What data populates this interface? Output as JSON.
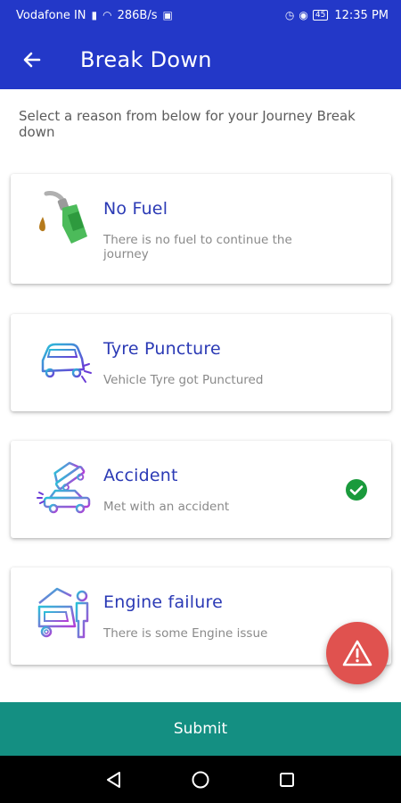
{
  "status_bar": {
    "carrier": "Vodafone IN",
    "speed": "286B/s",
    "battery": "45",
    "time": "12:35 PM"
  },
  "app_bar": {
    "title": "Break Down"
  },
  "prompt": "Select a reason from below for your Journey Break down",
  "reasons": [
    {
      "title": "No Fuel",
      "subtitle": "There is no fuel to continue the journey",
      "icon": "fuel-pump-icon",
      "selected": false
    },
    {
      "title": "Tyre Puncture",
      "subtitle": "Vehicle Tyre got Punctured",
      "icon": "car-puncture-icon",
      "selected": false
    },
    {
      "title": "Accident",
      "subtitle": "Met with an accident",
      "icon": "car-accident-icon",
      "selected": true
    },
    {
      "title": "Engine failure",
      "subtitle": "There is some Engine issue",
      "icon": "engine-repair-icon",
      "selected": false
    }
  ],
  "submit_label": "Submit",
  "colors": {
    "primary": "#2338c8",
    "title_text": "#2b3ab5",
    "submit": "#148f82",
    "fab": "#e0524f",
    "check": "#1a9a3c"
  }
}
